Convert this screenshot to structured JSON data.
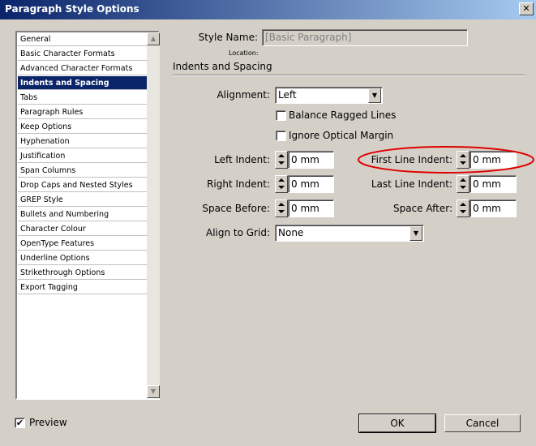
{
  "window": {
    "title": "Paragraph Style Options",
    "close_glyph": "✕"
  },
  "sidebar": {
    "items": [
      {
        "label": "General"
      },
      {
        "label": "Basic Character Formats"
      },
      {
        "label": "Advanced Character Formats"
      },
      {
        "label": "Indents and Spacing",
        "selected": true
      },
      {
        "label": "Tabs"
      },
      {
        "label": "Paragraph Rules"
      },
      {
        "label": "Keep Options"
      },
      {
        "label": "Hyphenation"
      },
      {
        "label": "Justification"
      },
      {
        "label": "Span Columns"
      },
      {
        "label": "Drop Caps and Nested Styles"
      },
      {
        "label": "GREP Style"
      },
      {
        "label": "Bullets and Numbering"
      },
      {
        "label": "Character Colour"
      },
      {
        "label": "OpenType Features"
      },
      {
        "label": "Underline Options"
      },
      {
        "label": "Strikethrough Options"
      },
      {
        "label": "Export Tagging"
      }
    ]
  },
  "style_name": {
    "label": "Style Name:",
    "value": "[Basic Paragraph]"
  },
  "location_label": "Location:",
  "section_title": "Indents and Spacing",
  "alignment": {
    "label": "Alignment:",
    "value": "Left"
  },
  "balance_ragged": {
    "label": "Balance Ragged Lines",
    "checked": false
  },
  "ignore_optical": {
    "label": "Ignore Optical Margin",
    "checked": false
  },
  "left_indent": {
    "label": "Left Indent:",
    "value": "0 mm"
  },
  "first_line_indent": {
    "label": "First Line Indent:",
    "value": "0 mm"
  },
  "right_indent": {
    "label": "Right Indent:",
    "value": "0 mm"
  },
  "last_line_indent": {
    "label": "Last Line Indent:",
    "value": "0 mm"
  },
  "space_before": {
    "label": "Space Before:",
    "value": "0 mm"
  },
  "space_after": {
    "label": "Space After:",
    "value": "0 mm"
  },
  "align_to_grid": {
    "label": "Align to Grid:",
    "value": "None"
  },
  "preview": {
    "label": "Preview",
    "checked": true
  },
  "buttons": {
    "ok": "OK",
    "cancel": "Cancel"
  },
  "colors": {
    "accent": "#0a246a",
    "annotation": "#e00000",
    "face": "#d4d0c8"
  },
  "checkmark_glyph": "✔",
  "dropdown_glyph": "▼",
  "scroll_up_glyph": "▲",
  "scroll_down_glyph": "▼"
}
